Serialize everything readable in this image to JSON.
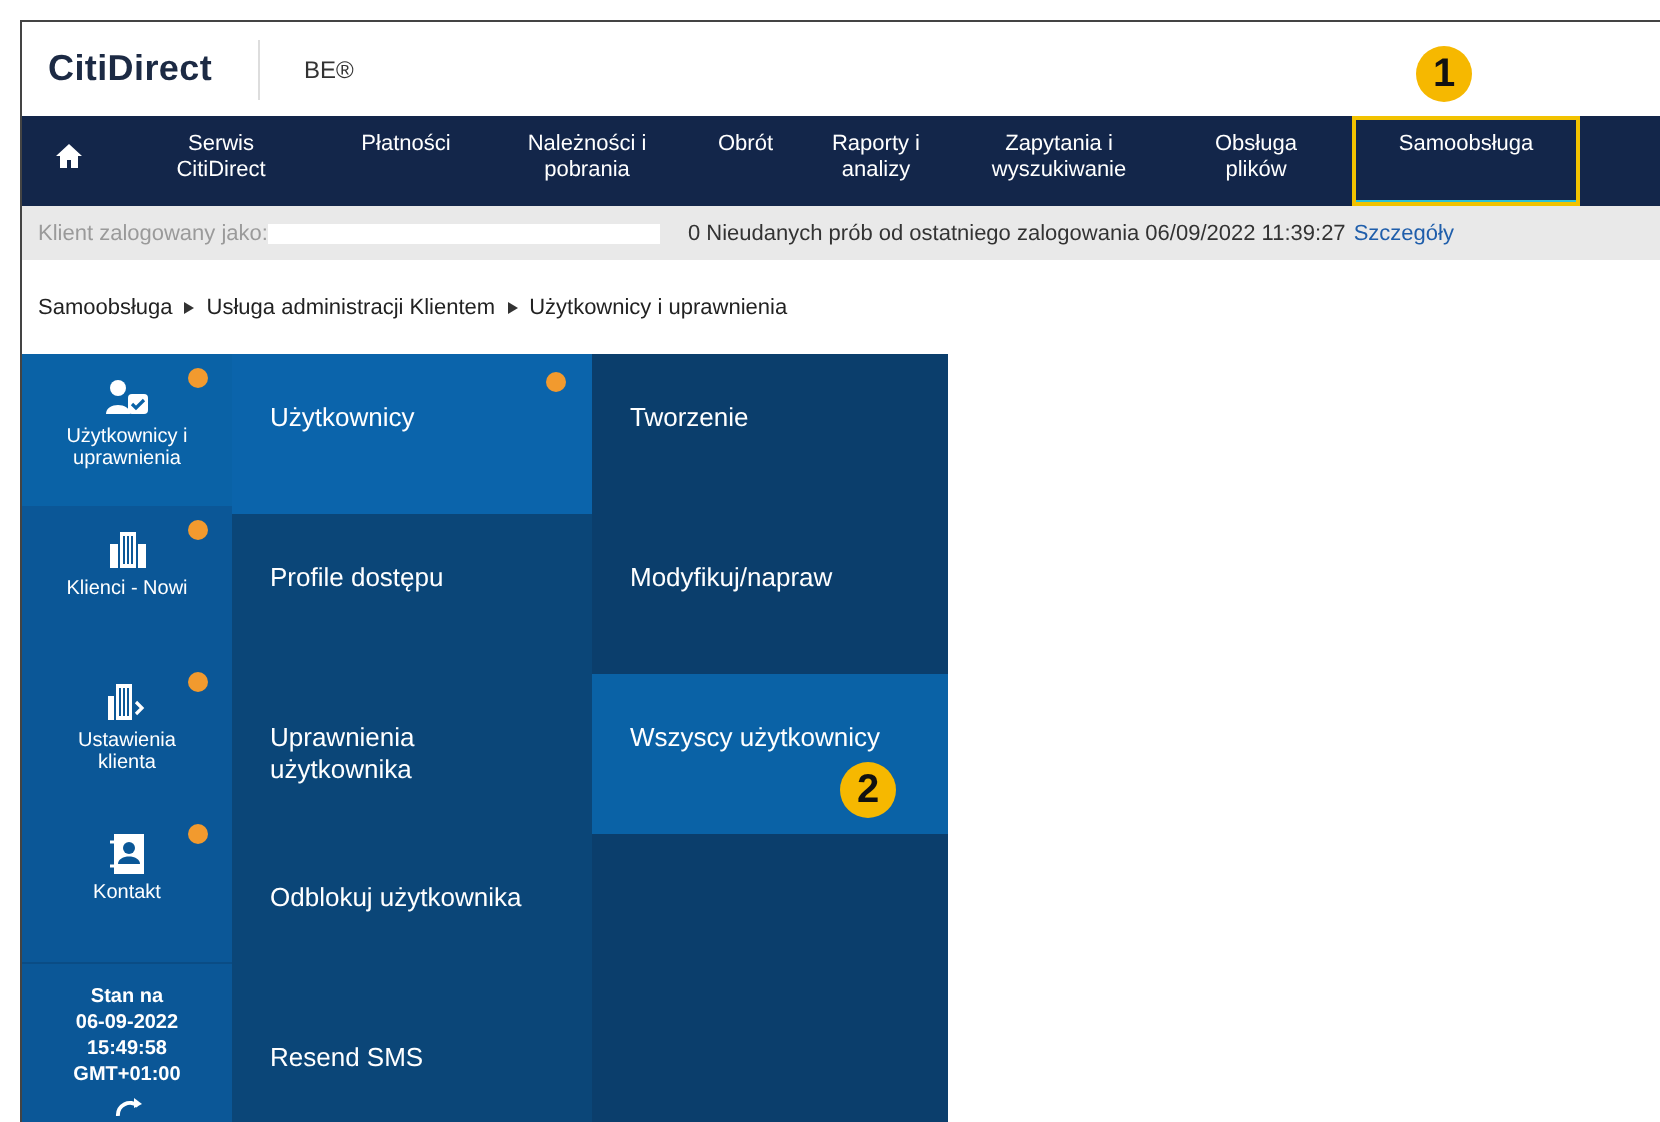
{
  "header": {
    "logo": "CitiDirect",
    "product": "BE®"
  },
  "nav": {
    "items": [
      {
        "kind": "home",
        "selected": false
      },
      {
        "kind": "text",
        "label": "Serwis CitiDirect",
        "selected": false
      },
      {
        "kind": "text",
        "label": "Płatności",
        "selected": false
      },
      {
        "kind": "text",
        "label": "Należności i pobrania",
        "selected": false
      },
      {
        "kind": "text",
        "label": "Obrót",
        "selected": false
      },
      {
        "kind": "text",
        "label": "Raporty i analizy",
        "selected": false
      },
      {
        "kind": "text",
        "label": "Zapytania i wyszukiwanie",
        "selected": false
      },
      {
        "kind": "text",
        "label": "Obsługa plików",
        "selected": false
      },
      {
        "kind": "text",
        "label": "Samoobsługa",
        "selected": true
      }
    ]
  },
  "status_line": {
    "logged_as": "Klient zalogowany jako:",
    "message": "0 Nieudanych prób od ostatniego zalogowania 06/09/2022 11:39:27",
    "details_link": "Szczegóły"
  },
  "breadcrumb": [
    "Samoobsługa",
    "Usługa administracji Klientem",
    "Użytkownicy i uprawnienia"
  ],
  "menu": {
    "categories": [
      {
        "kind": "users",
        "label": "Użytkownicy i uprawnienia",
        "selected": true,
        "dot": true
      },
      {
        "kind": "building",
        "label": "Klienci - Nowi",
        "selected": false,
        "dot": true
      },
      {
        "kind": "building-settings",
        "label": "Ustawienia klienta",
        "selected": false,
        "dot": true
      },
      {
        "kind": "contact",
        "label": "Kontakt",
        "selected": false,
        "dot": true
      }
    ],
    "status": [
      "Stan na",
      "06-09-2022",
      "15:49:58",
      "GMT+01:00"
    ],
    "submenu": [
      {
        "label": "Użytkownicy",
        "selected": true,
        "dot": true
      },
      {
        "label": "Profile dostępu",
        "selected": false,
        "dot": false
      },
      {
        "label": "Uprawnienia użytkownika",
        "selected": false,
        "dot": false
      },
      {
        "label": "Odblokuj użytkownika",
        "selected": false,
        "dot": false
      },
      {
        "label": "Resend SMS",
        "selected": false,
        "dot": false
      }
    ],
    "actions": [
      {
        "label": "Tworzenie",
        "selected": false
      },
      {
        "label": "Modyfikuj/napraw",
        "selected": false
      },
      {
        "label": "Wszyscy użytkownicy",
        "selected": true
      }
    ]
  },
  "annotations": [
    {
      "number": "1"
    },
    {
      "number": "2"
    }
  ]
}
